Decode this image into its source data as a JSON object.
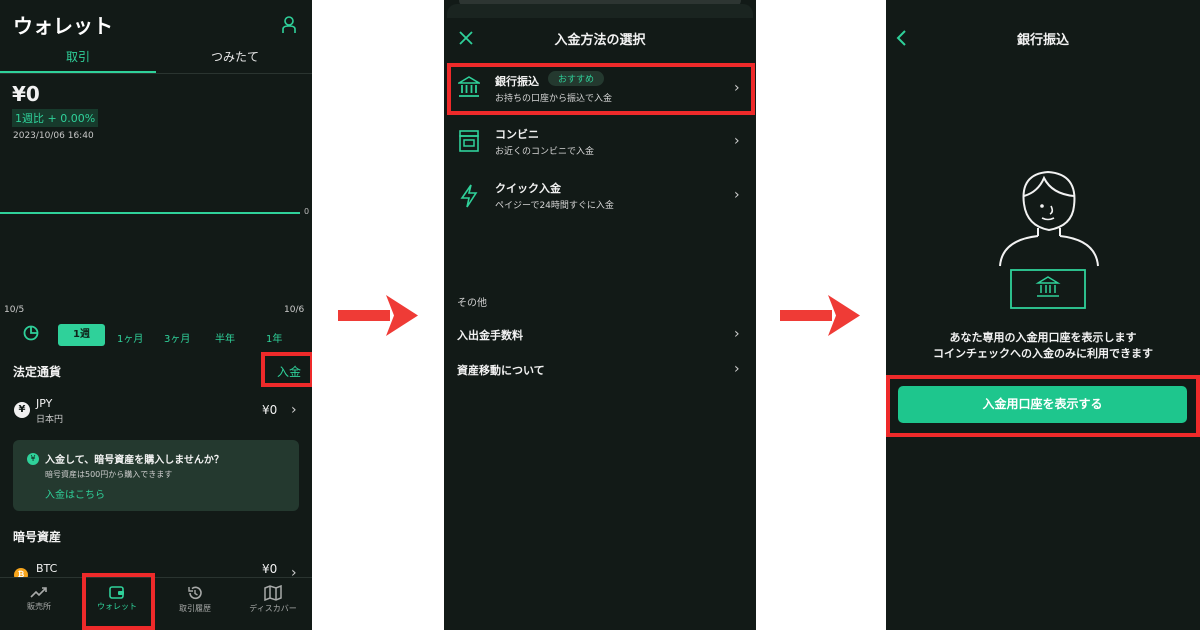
{
  "colors": {
    "background": "#121a17",
    "accent": "#2fd19a",
    "highlight": "#ee2a2a",
    "arrow": "#ef3b36"
  },
  "screen1": {
    "title": "ウォレット",
    "tabs": [
      "取引",
      "つみたて"
    ],
    "balance": "¥0",
    "weekly_change": "1週比 + 0.00%",
    "datetime": "2023/10/06 16:40",
    "chart_zero": "0",
    "date_start": "10/5",
    "date_end": "10/6",
    "periods": [
      "1週",
      "1ヶ月",
      "3ヶ月",
      "半年",
      "1年"
    ],
    "fiat_heading": "法定通貨",
    "deposit_button": "入金",
    "jpy_symbol": "¥",
    "jpy_code": "JPY",
    "jpy_name": "日本円",
    "jpy_value": "¥0",
    "promo_icon": "¥",
    "promo_title": "入金して、暗号資産を購入しませんか？",
    "promo_sub": "暗号資産は500円から購入できます",
    "promo_link": "入金はこちら",
    "crypto_heading": "暗号資産",
    "btc_symbol": "₿",
    "btc_code": "BTC",
    "btc_value": "¥0",
    "nav": [
      "販売所",
      "ウォレット",
      "取引履歴",
      "ディスカバー"
    ]
  },
  "screen2": {
    "title": "入金方法の選択",
    "options": [
      {
        "title": "銀行振込",
        "tag": "おすすめ",
        "sub": "お持ちの口座から振込で入金",
        "icon": "bank-icon"
      },
      {
        "title": "コンビニ",
        "sub": "お近くのコンビニで入金",
        "icon": "store-icon"
      },
      {
        "title": "クイック入金",
        "sub": "ペイジーで24時間すぐに入金",
        "icon": "lightning-icon"
      }
    ],
    "other_heading": "その他",
    "links": [
      "入出金手数料",
      "資産移動について"
    ]
  },
  "screen3": {
    "title": "銀行振込",
    "line1": "あなた専用の入金用口座を表示します",
    "line2": "コインチェックへの入金のみに利用できます",
    "cta": "入金用口座を表示する"
  }
}
